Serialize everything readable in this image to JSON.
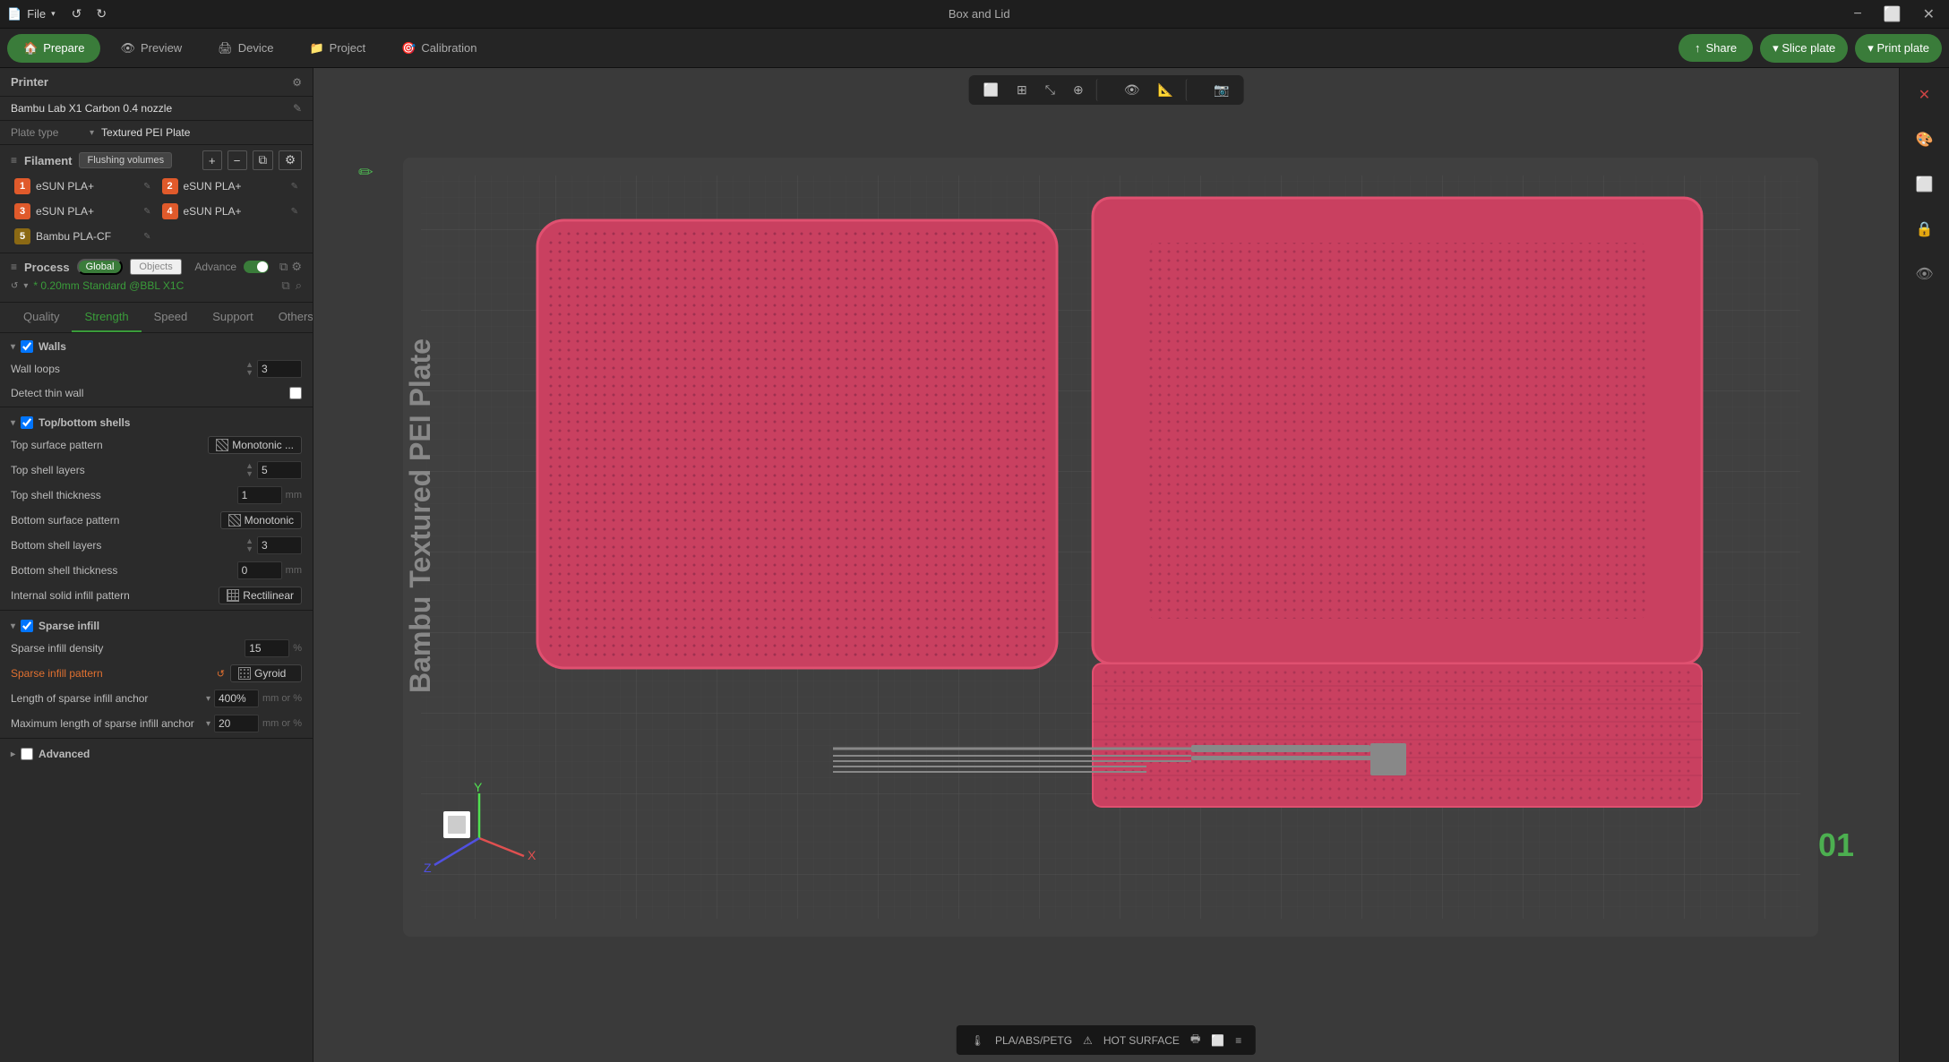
{
  "window": {
    "title": "Box and Lid"
  },
  "titlebar": {
    "file_menu": "File",
    "undo_tooltip": "Undo",
    "redo_tooltip": "Redo"
  },
  "tabs": {
    "prepare": "Prepare",
    "preview": "Preview",
    "device": "Device",
    "project": "Project",
    "calibration": "Calibration"
  },
  "topright": {
    "share": "Share",
    "slice_plate": "Slice plate",
    "print_plate": "Print plate"
  },
  "printer": {
    "label": "Printer",
    "name": "Bambu Lab X1 Carbon 0.4 nozzle",
    "plate_type_label": "Plate type",
    "plate_type_value": "Textured PEI Plate"
  },
  "filament": {
    "label": "Filament",
    "flushing_volumes": "Flushing volumes",
    "items": [
      {
        "num": "1",
        "name": "eSUN PLA+",
        "color": "#e05a2b"
      },
      {
        "num": "2",
        "name": "eSUN PLA+",
        "color": "#e05a2b"
      },
      {
        "num": "3",
        "name": "eSUN PLA+",
        "color": "#e05a2b"
      },
      {
        "num": "4",
        "name": "eSUN PLA+",
        "color": "#e05a2b"
      },
      {
        "num": "5",
        "name": "Bambu PLA-CF",
        "color": "#8b6914"
      }
    ]
  },
  "process": {
    "label": "Process",
    "global_tag": "Global",
    "objects_tag": "Objects",
    "advance_label": "Advance",
    "profile_name": "* 0.20mm Standard @BBL X1C"
  },
  "process_tabs": {
    "quality": "Quality",
    "strength": "Strength",
    "speed": "Speed",
    "support": "Support",
    "others": "Others",
    "active": "Strength"
  },
  "settings": {
    "walls_label": "Walls",
    "wall_loops_label": "Wall loops",
    "wall_loops_value": "3",
    "detect_thin_wall_label": "Detect thin wall",
    "topbottom_label": "Top/bottom shells",
    "top_surface_pattern_label": "Top surface pattern",
    "top_surface_pattern_value": "Monotonic ...",
    "top_shell_layers_label": "Top shell layers",
    "top_shell_layers_value": "5",
    "top_shell_thickness_label": "Top shell thickness",
    "top_shell_thickness_value": "1",
    "top_shell_thickness_unit": "mm",
    "bottom_surface_pattern_label": "Bottom surface pattern",
    "bottom_surface_pattern_value": "Monotonic",
    "bottom_shell_layers_label": "Bottom shell layers",
    "bottom_shell_layers_value": "3",
    "bottom_shell_thickness_label": "Bottom shell thickness",
    "bottom_shell_thickness_value": "0",
    "bottom_shell_thickness_unit": "mm",
    "internal_solid_infill_label": "Internal solid infill pattern",
    "internal_solid_infill_value": "Rectilinear",
    "sparse_infill_label": "Sparse infill",
    "sparse_infill_density_label": "Sparse infill density",
    "sparse_infill_density_value": "15",
    "sparse_infill_density_unit": "%",
    "sparse_infill_pattern_label": "Sparse infill pattern",
    "sparse_infill_pattern_value": "Gyroid",
    "sparse_infill_anchor_label": "Length of sparse infill anchor",
    "sparse_infill_anchor_value": "400%",
    "sparse_infill_anchor_unit": "mm or %",
    "max_sparse_anchor_label": "Maximum length of sparse infill anchor",
    "max_sparse_anchor_value": "20",
    "max_sparse_anchor_unit": "mm or %",
    "advanced_label": "Advanced"
  },
  "statusbar": {
    "material": "PLA/ABS/PETG",
    "hot_surface": "HOT SURFACE"
  },
  "plate_number": "01",
  "icons": {
    "settings": "⚙",
    "edit": "✎",
    "add": "+",
    "remove": "−",
    "copy": "⧉",
    "config": "≡",
    "search": "⌕",
    "undo": "↺",
    "redo": "↻",
    "box": "⬜",
    "grid": "⊞",
    "layers": "≡",
    "view3d": "◳",
    "ortho": "⊡",
    "close": "✕",
    "eye": "👁",
    "lock": "🔒",
    "slice_icon": "◈",
    "chevron_down": "▾",
    "chevron_right": "▸"
  }
}
